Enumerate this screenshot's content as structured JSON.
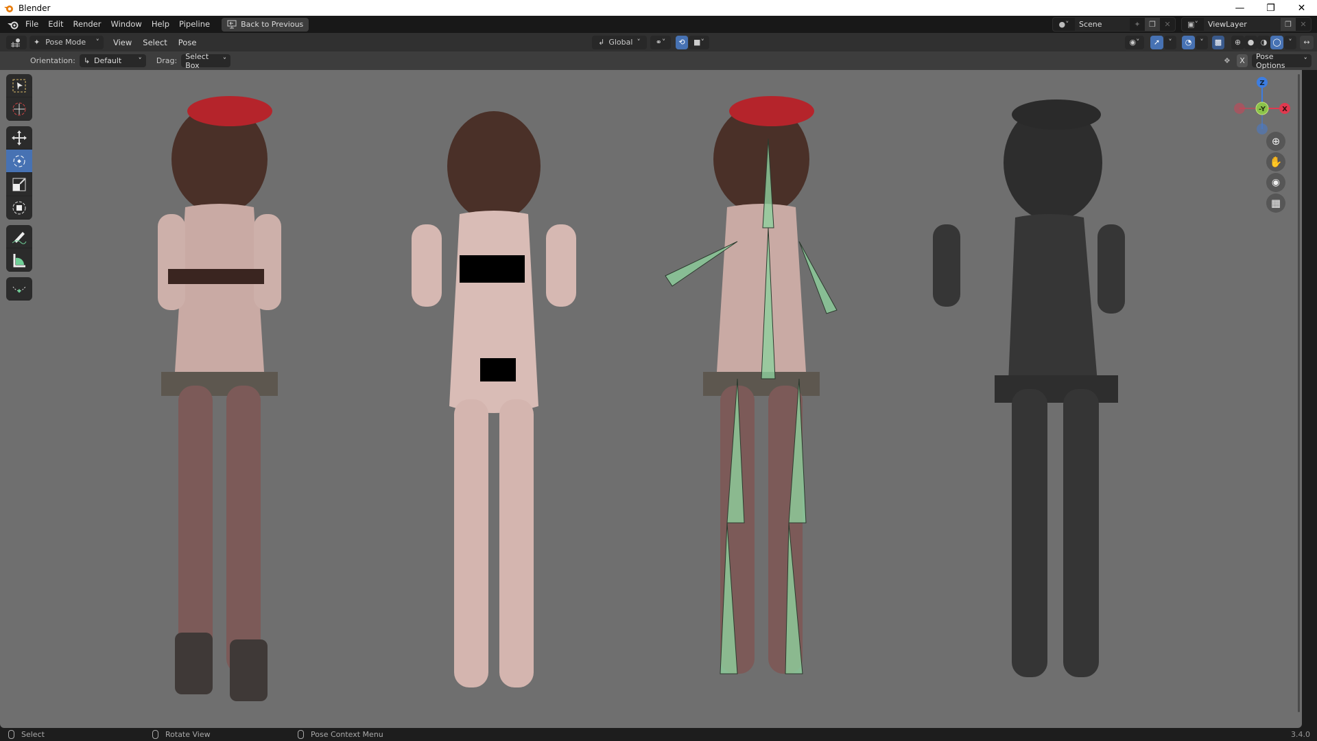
{
  "window": {
    "title": "Blender",
    "controls": [
      "minimize",
      "restore",
      "close"
    ]
  },
  "topbar": {
    "menus": [
      "File",
      "Edit",
      "Render",
      "Window",
      "Help",
      "Pipeline"
    ],
    "back_button": "Back to Previous",
    "scene": {
      "name": "Scene"
    },
    "view_layer": {
      "name": "ViewLayer"
    }
  },
  "viewport_header": {
    "mode": "Pose Mode",
    "menus": [
      "View",
      "Select",
      "Pose"
    ],
    "transform_orientation": "Global"
  },
  "tool_settings": {
    "orientation_label": "Orientation:",
    "orientation_value": "Default",
    "drag_label": "Drag:",
    "drag_value": "Select Box",
    "mirror_x": "X",
    "pose_options": "Pose Options"
  },
  "toolbar": {
    "tools": [
      {
        "name": "select-box",
        "active": false
      },
      {
        "name": "cursor",
        "active": false
      },
      {
        "name": "move",
        "active": false
      },
      {
        "name": "rotate",
        "active": true
      },
      {
        "name": "scale",
        "active": false
      },
      {
        "name": "transform",
        "active": false
      },
      {
        "name": "annotate",
        "active": false
      },
      {
        "name": "measure",
        "active": false
      },
      {
        "name": "bone-size",
        "active": false
      }
    ]
  },
  "gizmo": {
    "axes": [
      "Z",
      "-Y",
      "X"
    ]
  },
  "viewport": {
    "figures": [
      {
        "label": "render-preview",
        "shading": "material"
      },
      {
        "label": "render-preview-base",
        "shading": "material"
      },
      {
        "label": "armature-preview",
        "shading": "material-with-bones"
      },
      {
        "label": "wireframe-preview",
        "shading": "wireframe"
      }
    ]
  },
  "statusbar": {
    "items": [
      "Select",
      "Rotate View",
      "Pose Context Menu"
    ],
    "version": "3.4.0"
  },
  "colors": {
    "accent": "#4772b3",
    "viewport_bg": "#6f6f6f",
    "bone": "#8fd19e",
    "axis_x": "#e0394f",
    "axis_y": "#8bc34a",
    "axis_z": "#3d7de0"
  }
}
